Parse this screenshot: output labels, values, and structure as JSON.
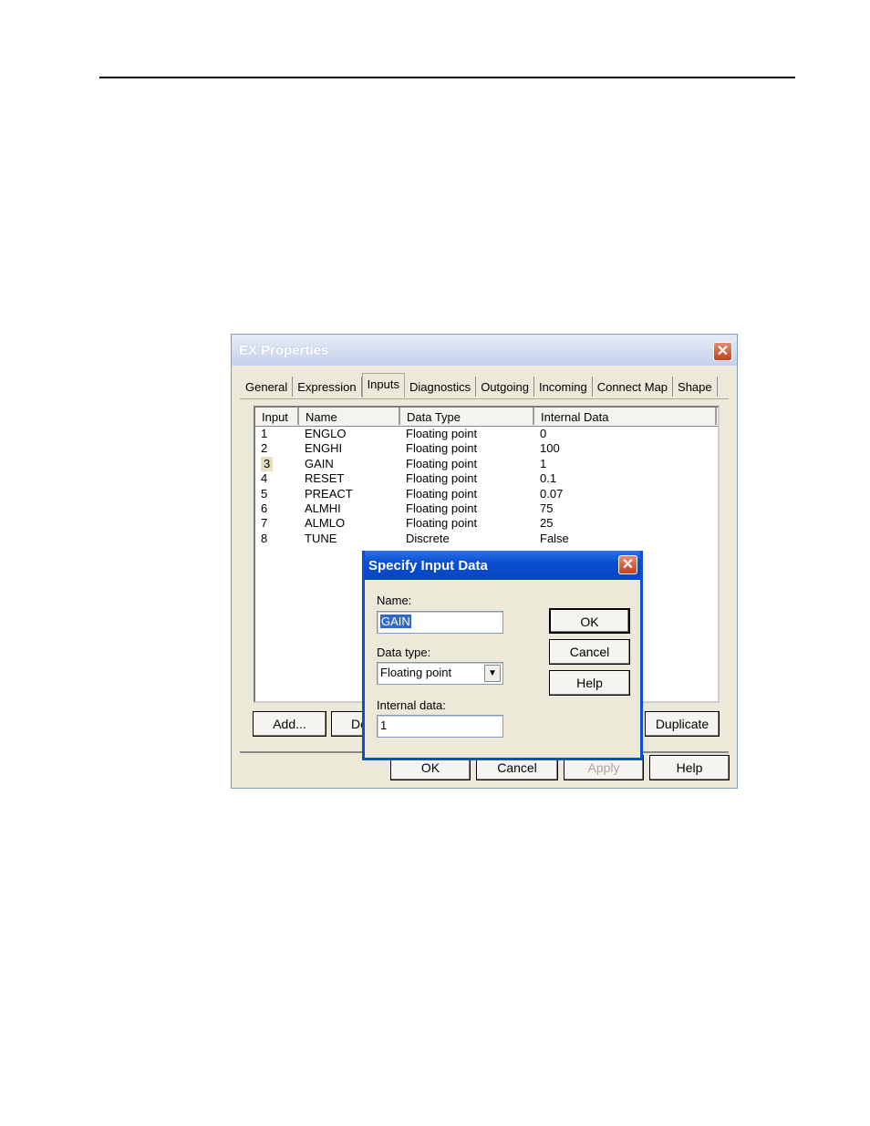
{
  "window": {
    "title": "EX Properties",
    "tabs": [
      "General",
      "Expression",
      "Inputs",
      "Diagnostics",
      "Outgoing",
      "Incoming",
      "Connect Map",
      "Shape"
    ],
    "active_tab": "Inputs",
    "columns": [
      "Input",
      "Name",
      "Data Type",
      "Internal Data"
    ],
    "rows": [
      {
        "input": "1",
        "name": "ENGLO",
        "type": "Floating point",
        "data": "0"
      },
      {
        "input": "2",
        "name": "ENGHI",
        "type": "Floating point",
        "data": "100"
      },
      {
        "input": "3",
        "name": "GAIN",
        "type": "Floating point",
        "data": "1"
      },
      {
        "input": "4",
        "name": "RESET",
        "type": "Floating point",
        "data": "0.1"
      },
      {
        "input": "5",
        "name": "PREACT",
        "type": "Floating point",
        "data": "0.07"
      },
      {
        "input": "6",
        "name": "ALMHI",
        "type": "Floating point",
        "data": "75"
      },
      {
        "input": "7",
        "name": "ALMLO",
        "type": "Floating point",
        "data": "25"
      },
      {
        "input": "8",
        "name": "TUNE",
        "type": "Discrete",
        "data": "False"
      }
    ],
    "selected_row": "3",
    "buttons": {
      "add": "Add...",
      "delete_partial": "De",
      "duplicate": "Duplicate",
      "ok": "OK",
      "cancel": "Cancel",
      "apply": "Apply",
      "help": "Help"
    }
  },
  "dialog": {
    "title": "Specify Input Data",
    "name_label": "Name:",
    "name_value": "GAIN",
    "type_label": "Data type:",
    "type_value": "Floating point",
    "internal_label": "Internal data:",
    "internal_value": "1",
    "ok": "OK",
    "cancel": "Cancel",
    "help": "Help"
  }
}
